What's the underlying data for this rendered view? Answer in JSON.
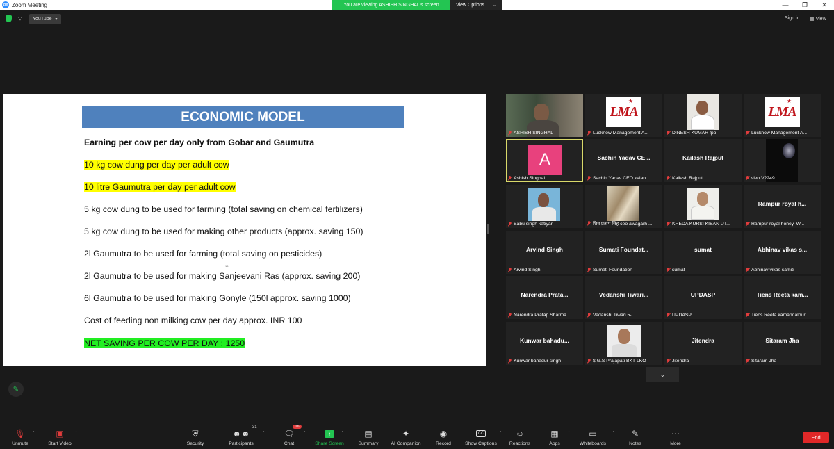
{
  "window": {
    "title": "Zoom Meeting"
  },
  "share_banner": {
    "text": "You are viewing ASHISH SINGHAL's screen",
    "view_options": "View Options"
  },
  "top_bar": {
    "youtube": "YouTube",
    "sign_in": "Sign in",
    "view": "View"
  },
  "slide": {
    "title": "ECONOMIC MODEL",
    "lines": [
      {
        "text": "Earning per cow per day only from Gobar and Gaumutra",
        "style": "bold"
      },
      {
        "text": "10 kg cow dung per day per adult cow",
        "style": "yellow"
      },
      {
        "text": "10 litre Gaumutra per day per adult cow",
        "style": "yellow"
      },
      {
        "text": "5 kg cow dung to be used for farming (total saving on chemical fertilizers)",
        "style": "plain"
      },
      {
        "text": "5 kg cow dung to be used for making other products (approx. saving  150)",
        "style": "plain"
      },
      {
        "text": "2l Gaumutra to be used for farming (total saving on pesticides)",
        "style": "plain"
      },
      {
        "text": "2l Gaumutra to be used for making Sanjeevani Ras (approx. saving 200)",
        "style": "plain"
      },
      {
        "text": "6l Gaumutra to be used for making Gonyle (150l approx. saving 1000)",
        "style": "plain"
      },
      {
        "text": "Cost of feeding non milking cow per day approx. INR 100",
        "style": "plain"
      },
      {
        "text": "NET SAVING PER COW PER DAY : 1250",
        "style": "green"
      }
    ],
    "tiny_mark": "16"
  },
  "participants": [
    {
      "label": "ASHISH SINGHAL",
      "kind": "video-ashish"
    },
    {
      "label": "Lucknow Management A...",
      "kind": "lma"
    },
    {
      "label": "DINESH KUMAR fpo",
      "kind": "video-dinesh"
    },
    {
      "label": "Lucknow Management A...",
      "kind": "lma"
    },
    {
      "label": "Ashish Singhal",
      "kind": "avatar",
      "initial": "A",
      "active": true
    },
    {
      "label": "Sachin Yadav CEO kalan ...",
      "name": "Sachin  Yadav  CE...",
      "kind": "name"
    },
    {
      "label": "Kailash Rajput",
      "name": "Kailash Rajput",
      "kind": "name"
    },
    {
      "label": "vivo V2249",
      "kind": "video-vivo"
    },
    {
      "label": "Babu singh katiyar",
      "kind": "video-babu"
    },
    {
      "label": "शिव प्रताप सिंह ceo awagarh ...",
      "kind": "video-shiv"
    },
    {
      "label": "KHEDA KURSI KISAN UT...",
      "kind": "video-kheda"
    },
    {
      "label": "Rampur royal honey. W...",
      "name": "Rampur royal h...",
      "kind": "name"
    },
    {
      "label": "Arvind Singh",
      "name": "Arvind Singh",
      "kind": "name"
    },
    {
      "label": "Sumati Foundation",
      "name": "Sumati  Foundat...",
      "kind": "name"
    },
    {
      "label": "sumat",
      "name": "sumat",
      "kind": "name"
    },
    {
      "label": "Abhinav vikas samiti",
      "name": "Abhinav vikas s...",
      "kind": "name"
    },
    {
      "label": "Narendra Pratap Sharma",
      "name": "Narendra  Prata...",
      "kind": "name"
    },
    {
      "label": "Vedanshi Tiwari 5-I",
      "name": "Vedanshi  Tiwari...",
      "kind": "name"
    },
    {
      "label": "UPDASP",
      "name": "UPDASP",
      "kind": "name"
    },
    {
      "label": "Tiens Reeta kamandalpur",
      "name": "Tiens Reeta kam...",
      "kind": "name"
    },
    {
      "label": "Kunwar bahadur singh",
      "name": "Kunwar  bahadu...",
      "kind": "name"
    },
    {
      "label": "$ G.S Prajapati BKT LKO",
      "kind": "video-gs"
    },
    {
      "label": "Jitendra",
      "name": "Jitendra",
      "kind": "name"
    },
    {
      "label": "Sitaram Jha",
      "name": "Sitaram Jha",
      "kind": "name"
    }
  ],
  "lma_text": "LMA",
  "toolbar": {
    "unmute": "Unmute",
    "start_video": "Start Video",
    "security": "Security",
    "participants": "Participants",
    "participants_count": "31",
    "chat": "Chat",
    "chat_badge": "16",
    "share_screen": "Share Screen",
    "summary": "Summary",
    "ai_companion": "AI Companion",
    "record": "Record",
    "show_captions": "Show Captions",
    "reactions": "Reactions",
    "apps": "Apps",
    "whiteboards": "Whiteboards",
    "notes": "Notes",
    "more": "More",
    "end": "End",
    "cc": "CC"
  }
}
